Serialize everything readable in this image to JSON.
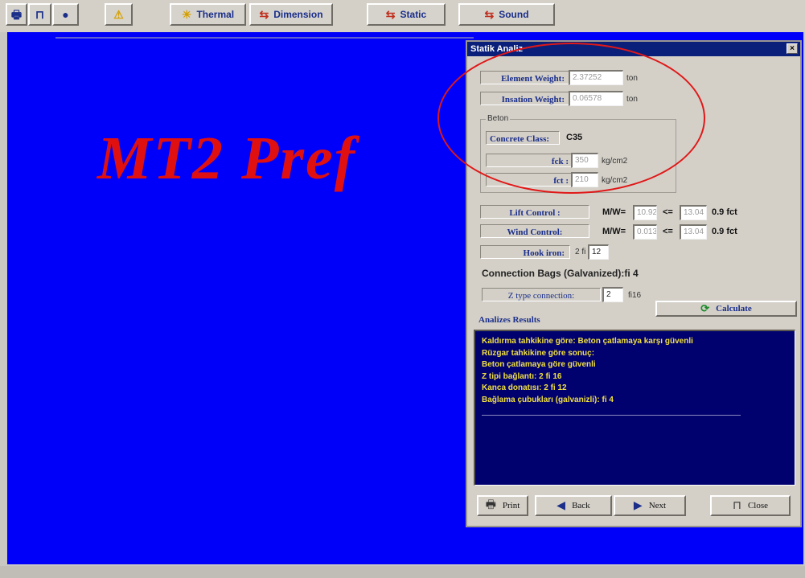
{
  "toolbar": {
    "icon_buttons": [
      {
        "icon": "printer-icon",
        "glyph": "🖶"
      },
      {
        "icon": "crane-icon",
        "glyph": "⊓"
      },
      {
        "icon": "globe-icon",
        "glyph": "●"
      },
      {
        "icon": "warning-icon",
        "glyph": "⚠"
      }
    ],
    "tabs": [
      {
        "label": "Thermal",
        "icon": "sun-icon",
        "glyph": "☀"
      },
      {
        "label": "Dimension",
        "icon": "arrows-icon",
        "glyph": "⇆"
      },
      {
        "label": "Static",
        "icon": "arrows-icon",
        "glyph": "⇆"
      },
      {
        "label": "Sound",
        "icon": "arrows-icon",
        "glyph": "⇆"
      }
    ]
  },
  "background": {
    "logo": "MT2 Pref"
  },
  "dialog": {
    "title": "Statik Analiz",
    "close": "×",
    "element_weight": {
      "label": "Element Weight:",
      "value": "2.37252",
      "unit": "ton"
    },
    "insulation_weight": {
      "label": "Insation Weight:",
      "value": "0.06578",
      "unit": "ton"
    },
    "beton": {
      "legend": "Beton",
      "class_label": "Concrete Class:",
      "class_value": "C35",
      "fck": {
        "label": "fck :",
        "value": "350",
        "unit": "kg/cm2"
      },
      "fct": {
        "label": "fct :",
        "value": "210",
        "unit": "kg/cm2"
      }
    },
    "lift": {
      "label": "Lift Control :",
      "formula": "M/W=",
      "value": "10.92",
      "op": "<=",
      "limit": "13.04",
      "suffix": "0.9 fct"
    },
    "wind": {
      "label": "Wind Control:",
      "formula": "M/W=",
      "value": "0.013",
      "op": "<=",
      "limit": "13.04",
      "suffix": "0.9 fct"
    },
    "hook": {
      "label": "Hook iron:",
      "prefix": "2 fi",
      "value": "12"
    },
    "bags": "Connection Bags (Galvanized):fi 4",
    "ztype": {
      "label": "Z type connection:",
      "value": "2",
      "suffix": "fi16"
    },
    "calculate": "Calculate",
    "results_label": "Analizes Results",
    "results": [
      "Kaldırma tahkikine göre: Beton çatlamaya karşı güvenli",
      "Rüzgar tahkikine göre sonuç:",
      "Beton çatlamaya göre güvenli",
      "Z tipi bağlantı: 2 fi 16",
      "Kanca donatısı: 2 fi 12",
      "Bağlama çubukları (galvanizli): fi 4"
    ],
    "buttons": {
      "print": "Print",
      "back": "Back",
      "next": "Next",
      "close": "Close"
    }
  },
  "colors": {
    "background_blue": "#0000fa",
    "logo_red": "#e01010",
    "title_bar": "#0a1f7a",
    "results_bg": "#00006e",
    "results_text": "#f0e040",
    "highlight": "#e01818"
  }
}
